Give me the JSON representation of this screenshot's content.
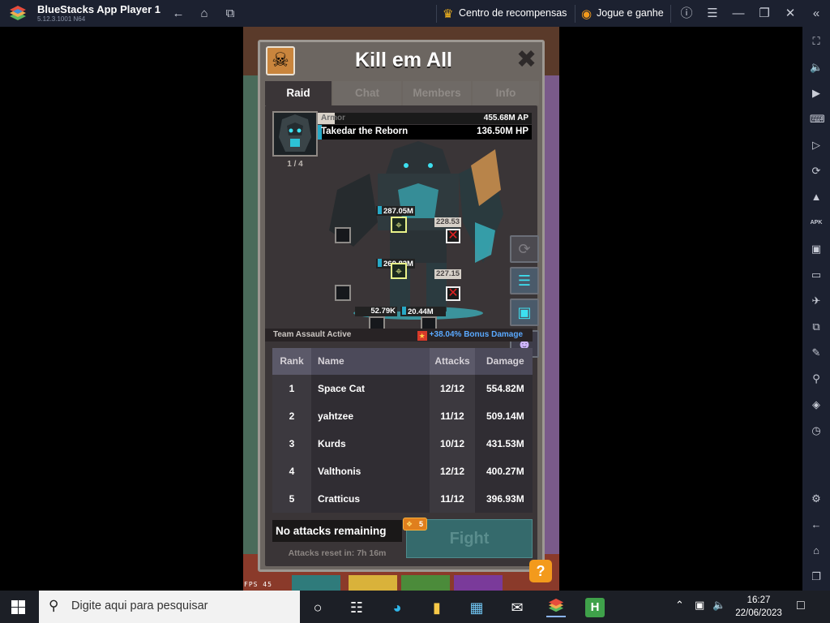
{
  "window": {
    "title": "BlueStacks App Player 1",
    "version": "5.12.3.1001 N64",
    "rewards_label": "Centro de recompensas",
    "play_earn_label": "Jogue e ganhe"
  },
  "raid": {
    "title": "Kill em All",
    "tabs": [
      "Raid",
      "Chat",
      "Members",
      "Info"
    ],
    "boss": {
      "armor_label": "Armor",
      "armor_value": "455.68M AP",
      "name": "Takedar the Reborn",
      "hp": "136.50M HP",
      "count": "1 / 4",
      "armor_fraction": 0.08,
      "hp_fraction": 0.02
    },
    "targets": {
      "head": "287.05M",
      "right_shoulder": "228.53",
      "core": "260.82M",
      "right_arm": "227.15",
      "left_leg": "52.79K",
      "right_leg": "20.44M"
    },
    "team_assault": "Team Assault Active",
    "bonus": "+38.04% Bonus Damage",
    "table": {
      "headers": [
        "Rank",
        "Name",
        "Attacks",
        "Damage"
      ],
      "rows": [
        {
          "rank": "1",
          "name": "Space Cat",
          "attacks": "12/12",
          "damage": "554.82M"
        },
        {
          "rank": "2",
          "name": "yahtzee",
          "attacks": "11/12",
          "damage": "509.14M"
        },
        {
          "rank": "3",
          "name": "Kurds",
          "attacks": "10/12",
          "damage": "431.53M"
        },
        {
          "rank": "4",
          "name": "Valthonis",
          "attacks": "12/12",
          "damage": "400.27M"
        },
        {
          "rank": "5",
          "name": "Cratticus",
          "attacks": "11/12",
          "damage": "396.93M"
        }
      ]
    },
    "no_attacks": "No attacks remaining",
    "ticket_count": "5",
    "fight_label": "Fight",
    "reset_text": "Attacks reset in: 7h 16m",
    "help": "?",
    "fps": "FPS 45"
  },
  "taskbar": {
    "search_placeholder": "Digite aqui para pesquisar",
    "time": "16:27",
    "date": "22/06/2023"
  }
}
